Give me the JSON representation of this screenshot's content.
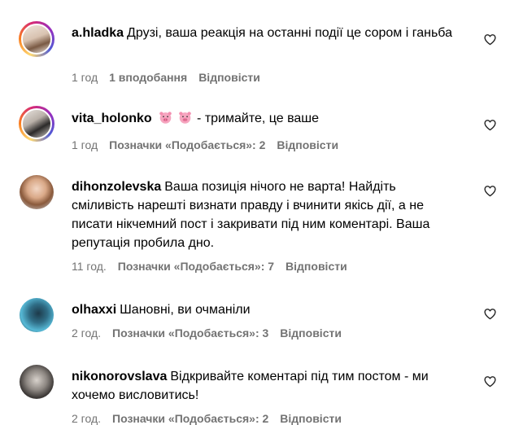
{
  "comments": [
    {
      "username": "a.hladka",
      "text": "Друзі, ваша реакція на останні події це сором і ганьба",
      "time": "1 год",
      "likes": "1 вподобання",
      "reply": "Відповісти"
    },
    {
      "username": "vita_holonko",
      "emojis": [
        "pig-face-emoji",
        "pig-face-emoji"
      ],
      "text": "- тримайте, це ваше",
      "time": "1 год",
      "likes": "Позначки «Подобається»: 2",
      "reply": "Відповісти"
    },
    {
      "username": "dihonzolevska",
      "text": "Ваша позиція нічого не варта! Найдіть сміливість нарешті визнати правду і вчинити якісь дії, а не писати нікчемний пост і закривати під ним коментарі. Ваша репутація пробила дно.",
      "time": "11 год.",
      "likes": "Позначки «Подобається»: 7",
      "reply": "Відповісти"
    },
    {
      "username": "olhaxxi",
      "text": "Шановні, ви очманіли",
      "time": "2 год.",
      "likes": "Позначки «Подобається»: 3",
      "reply": "Відповісти"
    },
    {
      "username": "nikonorovslava",
      "text": "Відкривайте коментарі під тим постом - ми хочемо висловитись!",
      "time": "2 год.",
      "likes": "Позначки «Подобається»: 2",
      "reply": "Відповісти"
    }
  ],
  "icons": {
    "like": "heart-outline-icon"
  },
  "colors": {
    "text": "#000000",
    "meta": "#737373",
    "story_ring_start": "#feda75",
    "story_ring_end": "#962fbf"
  }
}
